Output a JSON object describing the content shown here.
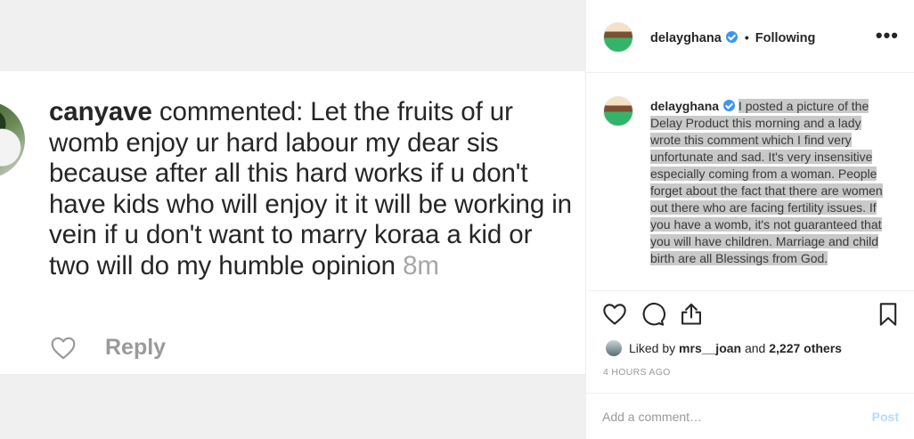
{
  "post_image": {
    "comment": {
      "username": "canyave",
      "text": " commented: Let the fruits of ur womb enjoy ur hard labour my dear sis because after all this hard works if u don't have kids who will enjoy it it will be working in vein if u don't want to marry koraa a kid or two will do my humble opinion ",
      "time": "8m",
      "reply_label": "Reply"
    }
  },
  "header": {
    "username": "delayghana",
    "separator": "•",
    "follow_status": "Following",
    "more_label": "•••"
  },
  "caption": {
    "username": "delayghana",
    "text": "I posted a picture of the Delay Product this morning and a lady wrote this comment which I find very unfortunate and sad. It's very insensitive especially coming from a woman. People forget about the fact that there are women out there who are facing fertility issues. If you have a womb, it's not guaranteed that you will have children. Marriage and child birth are all Blessings from God."
  },
  "likes": {
    "prefix": "Liked by ",
    "user": "mrs__joan",
    "middle": " and ",
    "others": "2,227 others"
  },
  "timestamp": "4 HOURS AGO",
  "comment_box": {
    "placeholder": "Add a comment…",
    "post_label": "Post"
  },
  "colors": {
    "verified": "#3897f0",
    "post_button": "#b3dbff",
    "caption_highlight": "#c9c9c9"
  }
}
